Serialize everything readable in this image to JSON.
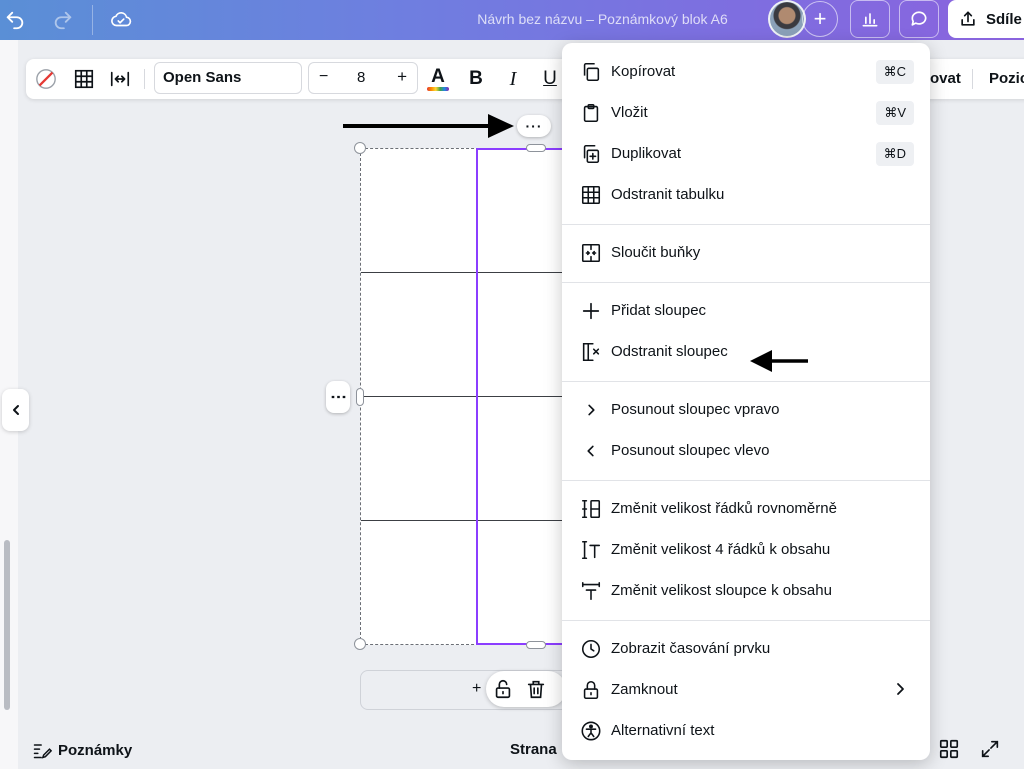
{
  "header": {
    "title": "Návrh bez názvu – Poznámkový blok A6",
    "share_label": "Sdíle",
    "add_symbol": "+",
    "icons": [
      "undo-icon",
      "redo-icon",
      "cloud-saved-icon",
      "chart-icon",
      "comment-icon",
      "upload-icon"
    ]
  },
  "toolbar": {
    "font_family": "Open Sans",
    "font_size": "8",
    "minus": "−",
    "plus": "+",
    "bold": "B",
    "italic": "I",
    "underline": "U",
    "text_color_letter": "A",
    "partial_label_1": "ovat",
    "partial_label_2": "Poziс"
  },
  "canvas": {
    "more_label": "···",
    "side_handle_label": "⋮",
    "add_page_symbol": "+"
  },
  "context_menu": {
    "groups": [
      [
        {
          "label": "Kopírovat",
          "shortcut": "⌘C",
          "icon": "copy-icon"
        },
        {
          "label": "Vložit",
          "shortcut": "⌘V",
          "icon": "paste-icon"
        },
        {
          "label": "Duplikovat",
          "shortcut": "⌘D",
          "icon": "duplicate-icon"
        },
        {
          "label": "Odstranit tabulku",
          "icon": "table-icon"
        }
      ],
      [
        {
          "label": "Sloučit buňky",
          "icon": "merge-cells-icon"
        }
      ],
      [
        {
          "label": "Přidat sloupec",
          "icon": "plus-icon"
        },
        {
          "label": "Odstranit sloupec",
          "icon": "delete-column-icon"
        }
      ],
      [
        {
          "label": "Posunout sloupec vpravo",
          "icon": "chevron-right-icon"
        },
        {
          "label": "Posunout sloupec vlevo",
          "icon": "chevron-left-icon"
        }
      ],
      [
        {
          "label": "Změnit velikost řádků rovnoměrně",
          "icon": "distribute-rows-icon"
        },
        {
          "label": "Změnit velikost 4 řádků k obsahu",
          "icon": "fit-rows-icon"
        },
        {
          "label": "Změnit velikost sloupce k obsahu",
          "icon": "fit-column-icon"
        }
      ],
      [
        {
          "label": "Zobrazit časování prvku",
          "icon": "clock-icon"
        },
        {
          "label": "Zamknout",
          "icon": "lock-icon",
          "submenu": true
        },
        {
          "label": "Alternativní text",
          "icon": "accessibility-icon"
        }
      ]
    ]
  },
  "footer": {
    "notes_label": "Poznámky",
    "page_label": "Strana"
  },
  "colors": {
    "selection": "#8b3dff",
    "header_gradient_start": "#5a8fd6",
    "header_gradient_end": "#8a63de"
  }
}
